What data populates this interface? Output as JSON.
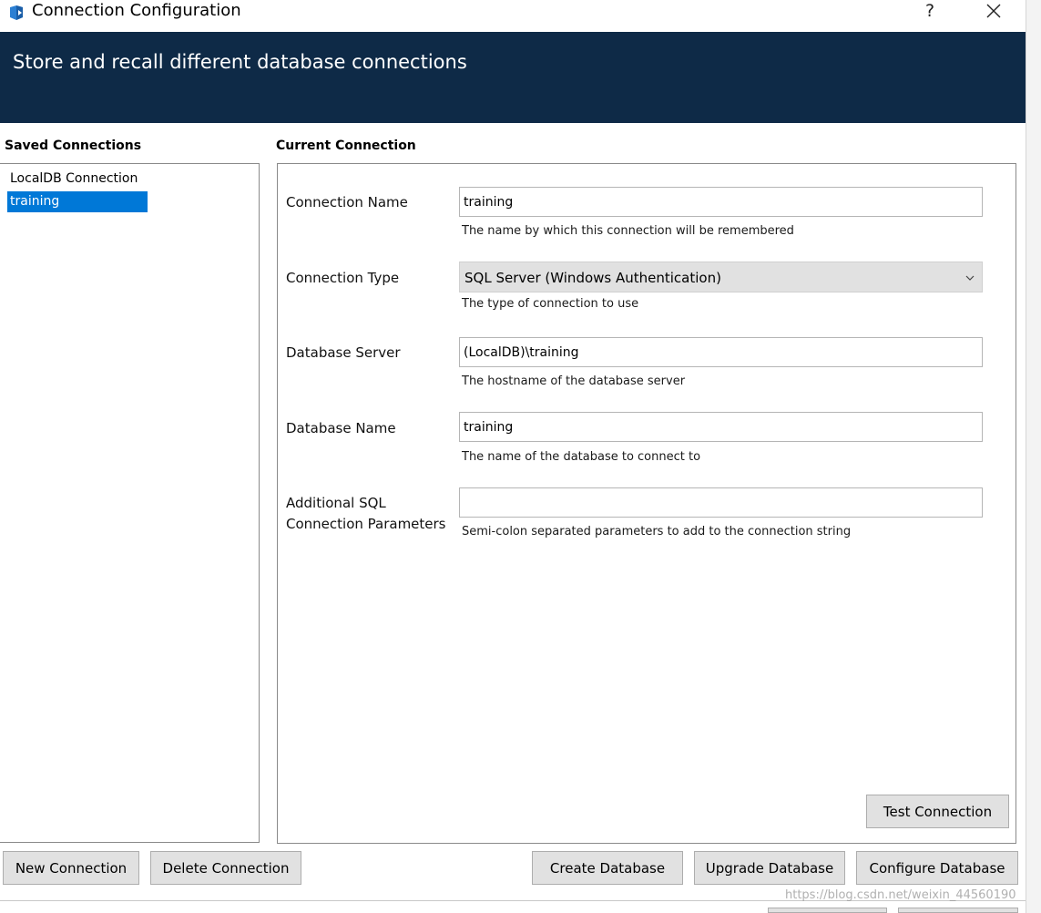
{
  "window": {
    "title": "Connection Configuration",
    "help_glyph": "?"
  },
  "banner": {
    "text": "Store and recall different database connections"
  },
  "saved_connections": {
    "heading": "Saved Connections",
    "items": [
      {
        "label": "LocalDB Connection",
        "selected": false
      },
      {
        "label": "training",
        "selected": true
      }
    ]
  },
  "current_connection": {
    "heading": "Current Connection",
    "fields": {
      "connection_name": {
        "label": "Connection Name",
        "value": "training",
        "hint": "The name by which this connection will be remembered"
      },
      "connection_type": {
        "label": "Connection Type",
        "value": "SQL Server (Windows Authentication)",
        "hint": "The type of connection to use"
      },
      "database_server": {
        "label": "Database Server",
        "value": "(LocalDB)\\training",
        "hint": "The hostname of the database server"
      },
      "database_name": {
        "label": "Database Name",
        "value": "training",
        "hint": "The name of the database to connect to"
      },
      "additional_parameters": {
        "label_line1": "Additional SQL",
        "label_line2": "Connection Parameters",
        "value": "",
        "hint": "Semi-colon separated parameters to add to the connection string"
      }
    },
    "test_button": "Test Connection"
  },
  "buttons": {
    "new_connection": "New Connection",
    "delete_connection": "Delete Connection",
    "create_database": "Create Database",
    "upgrade_database": "Upgrade Database",
    "configure_database": "Configure Database"
  },
  "watermark": "https://blog.csdn.net/weixin_44560190",
  "colors": {
    "banner_bg": "#0e2a47",
    "selection": "#0078d7",
    "button_bg": "#e1e1e1"
  }
}
